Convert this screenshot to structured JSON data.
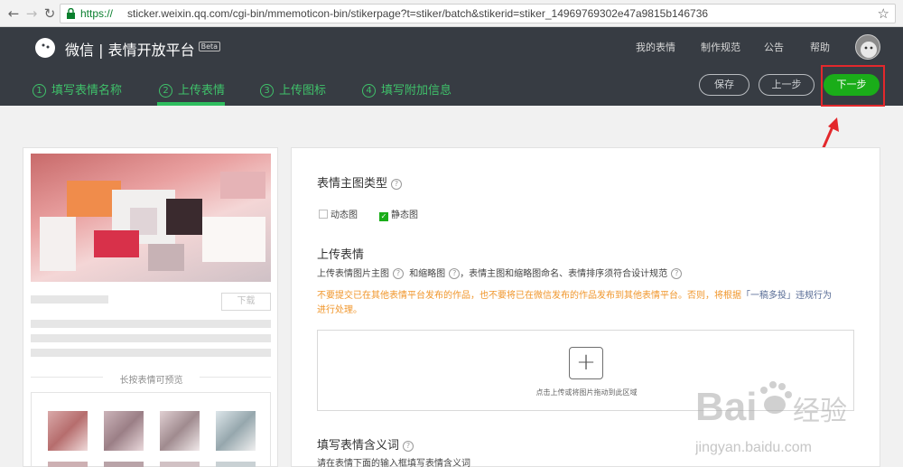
{
  "browser": {
    "url_scheme": "https://",
    "url_rest": "sticker.weixin.qq.com/cgi-bin/mmemoticon-bin/stikerpage?t=stiker/batch&stikerid=stiker_14969769302e47a9815b146736"
  },
  "header": {
    "brand": "微信 | 表情开放平台",
    "beta": "Beta",
    "nav": [
      "我的表情",
      "制作规范",
      "公告",
      "帮助"
    ]
  },
  "steps": [
    {
      "num": "1",
      "label": "填写表情名称"
    },
    {
      "num": "2",
      "label": "上传表情"
    },
    {
      "num": "3",
      "label": "上传图标"
    },
    {
      "num": "4",
      "label": "填写附加信息"
    }
  ],
  "actions": {
    "save": "保存",
    "prev": "上一步",
    "next": "下一步"
  },
  "preview": {
    "download": "下载",
    "longpress": "长按表情可预览"
  },
  "form": {
    "type_title": "表情主图类型",
    "type_options": [
      "动态图",
      "静态图"
    ],
    "type_selected": "静态图",
    "upload_title": "上传表情",
    "upload_desc_a": "上传表情图片主图",
    "upload_desc_b": "和缩略图",
    "upload_desc_c": "，表情主图和缩略图命名、表情排序须符合设计规范",
    "warn_a": "不要提交已在其他表情平台发布的作品，也不要将已在微信发布的作品发布到其他表情平台。否则，将根据",
    "warn_link": "「一稿多投」违规行为",
    "warn_b": "进行处理。",
    "drop_hint": "点击上传或将图片拖动到此区域",
    "meaning_title": "填写表情含义词",
    "meaning_desc": "请在表情下面的输入框填写表情含义词"
  },
  "watermark": {
    "brand": "Bai",
    "brand2": "经验",
    "site": "jingyan.baidu.com"
  },
  "colors": {
    "accent": "#1aad19",
    "header_bg": "#373c43",
    "highlight": "#e3282c",
    "warning": "#f0962b"
  }
}
